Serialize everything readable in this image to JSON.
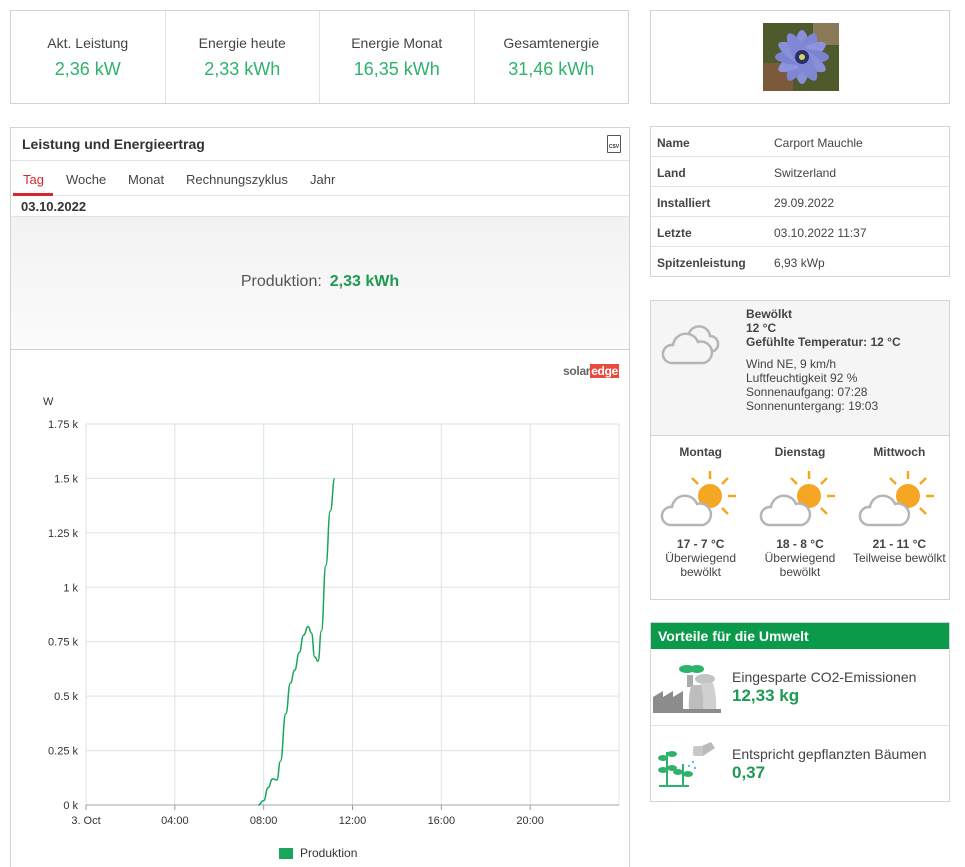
{
  "kpis": [
    {
      "label": "Akt. Leistung",
      "value": "2,36 kW"
    },
    {
      "label": "Energie heute",
      "value": "2,33 kWh"
    },
    {
      "label": "Energie Monat",
      "value": "16,35 kWh"
    },
    {
      "label": "Gesamtenergie",
      "value": "31,46 kWh"
    }
  ],
  "chart_panel": {
    "title": "Leistung und Energieertrag",
    "csv_icon_label": "CSV",
    "tabs": [
      {
        "label": "Tag",
        "active": true
      },
      {
        "label": "Woche",
        "active": false
      },
      {
        "label": "Monat",
        "active": false
      },
      {
        "label": "Rechnungszyklus",
        "active": false
      },
      {
        "label": "Jahr",
        "active": false
      }
    ],
    "date": "03.10.2022",
    "production_label": "Produktion:",
    "production_value": "2,33 kWh",
    "brand_solar": "solar",
    "brand_edge": "edge"
  },
  "chart_data": {
    "type": "line",
    "ylabel": "W",
    "yticks": [
      "0 k",
      "0.25 k",
      "0.5 k",
      "0.75 k",
      "1 k",
      "1.25 k",
      "1.5 k",
      "1.75 k"
    ],
    "xticks": [
      "3. Oct",
      "04:00",
      "08:00",
      "12:00",
      "16:00",
      "20:00"
    ],
    "ylim": [
      0,
      1750
    ],
    "xlim_hours": [
      0,
      24
    ],
    "grid": true,
    "legend_position": "bottom",
    "series": [
      {
        "name": "Produktion",
        "color": "#1aa55a",
        "x_hours": [
          7.75,
          8.0,
          8.2,
          8.4,
          8.6,
          8.75,
          9.0,
          9.2,
          9.4,
          9.6,
          9.8,
          10.0,
          10.15,
          10.3,
          10.45,
          10.6,
          10.8,
          11.0,
          11.2
        ],
        "y_watts": [
          0,
          20,
          80,
          120,
          115,
          200,
          420,
          560,
          620,
          700,
          780,
          820,
          790,
          680,
          660,
          800,
          1100,
          1350,
          1500
        ]
      }
    ]
  },
  "info": [
    {
      "key": "Name",
      "value": "Carport Mauchle"
    },
    {
      "key": "Land",
      "value": "Switzerland"
    },
    {
      "key": "Installiert",
      "value": "29.09.2022"
    },
    {
      "key": "Letzte",
      "value": "03.10.2022 11:37"
    },
    {
      "key": "Spitzenleistung",
      "value": "6,93 kWp"
    }
  ],
  "weather": {
    "condition": "Bewölkt",
    "temp": "12 °C",
    "feels_like": "Gefühlte Temperatur: 12 °C",
    "wind": "Wind NE, 9 km/h",
    "humidity": "Luftfeuchtigkeit 92 %",
    "sunrise": "Sonnenaufgang: 07:28",
    "sunset": "Sonnenuntergang: 19:03",
    "forecast": [
      {
        "day": "Montag",
        "temp": "17 - 7 °C",
        "desc1": "Überwiegend",
        "desc2": "bewölkt"
      },
      {
        "day": "Dienstag",
        "temp": "18 - 8 °C",
        "desc1": "Überwiegend",
        "desc2": "bewölkt"
      },
      {
        "day": "Mittwoch",
        "temp": "21 - 11 °C",
        "desc1": "Teilweise bewölkt",
        "desc2": ""
      }
    ]
  },
  "environment": {
    "title": "Vorteile für die Umwelt",
    "co2_label": "Eingesparte CO2-Emissionen",
    "co2_value": "12,33 kg",
    "trees_label": "Entspricht gepflanzten Bäumen",
    "trees_value": "0,37"
  },
  "icons": {
    "site_image": "flower-photo-icon",
    "weather_now": "cloud-icon",
    "forecast": "partly-cloudy-icon",
    "co2": "factory-icon",
    "trees": "watering-plant-icon"
  }
}
